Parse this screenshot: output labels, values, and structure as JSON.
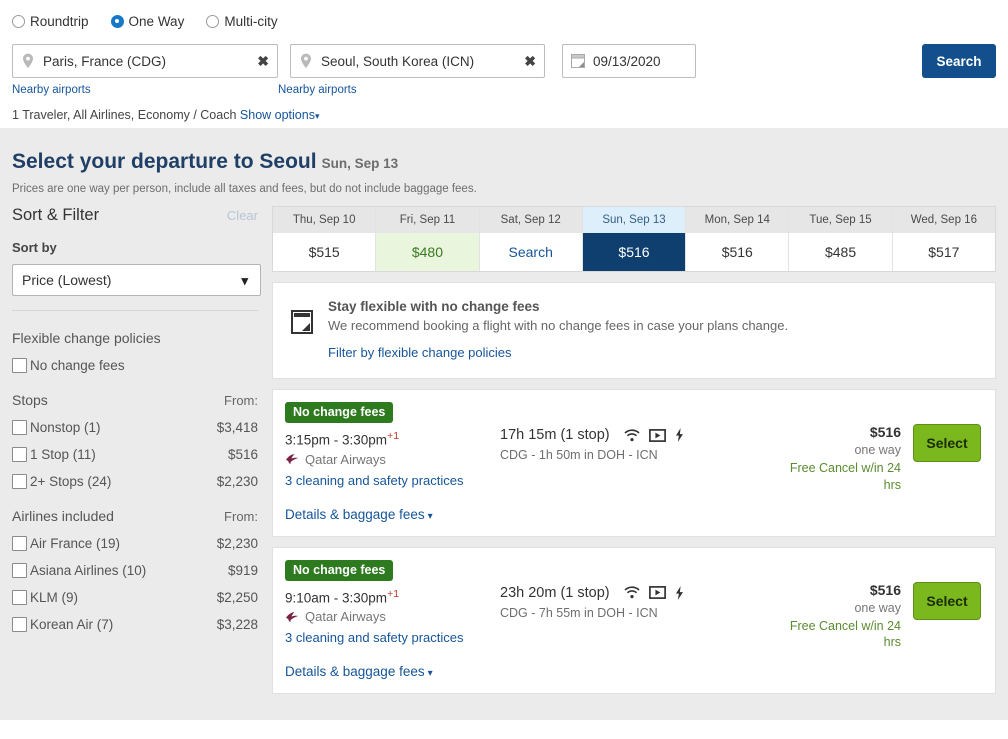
{
  "search": {
    "trip_types": [
      {
        "label": "Roundtrip",
        "selected": false
      },
      {
        "label": "One Way",
        "selected": true
      },
      {
        "label": "Multi-city",
        "selected": false
      }
    ],
    "origin": {
      "value": "Paris, France (CDG)",
      "nearby_label": "Nearby airports",
      "clear_label": "✖"
    },
    "destination": {
      "value": "Seoul, South Korea (ICN)",
      "nearby_label": "Nearby airports",
      "clear_label": "✖"
    },
    "date": {
      "value": "09/13/2020"
    },
    "search_button": "Search",
    "options_summary": "1 Traveler, All Airlines, Economy / Coach",
    "show_options": "Show options"
  },
  "results": {
    "title": "Select your departure to Seoul",
    "title_date": "Sun, Sep 13",
    "disclaimer": "Prices are one way per person, include all taxes and fees, but do not include baggage fees."
  },
  "sidebar": {
    "heading": "Sort & Filter",
    "clear": "Clear",
    "sort_by_label": "Sort by",
    "sort_selected": "Price (Lowest)",
    "sort_options": [
      "Price (Lowest)"
    ],
    "flexible_group": {
      "title": "Flexible change policies",
      "items": [
        {
          "label": "No change fees",
          "price": "",
          "checked": false
        }
      ]
    },
    "stops_group": {
      "title": "Stops",
      "from_label": "From:",
      "items": [
        {
          "label": "Nonstop (1)",
          "price": "$3,418",
          "checked": false
        },
        {
          "label": "1 Stop (11)",
          "price": "$516",
          "checked": false
        },
        {
          "label": "2+ Stops (24)",
          "price": "$2,230",
          "checked": false
        }
      ]
    },
    "airlines_group": {
      "title": "Airlines included",
      "from_label": "From:",
      "items": [
        {
          "label": "Air France (19)",
          "price": "$2,230",
          "checked": false
        },
        {
          "label": "Asiana Airlines (10)",
          "price": "$919",
          "checked": false
        },
        {
          "label": "KLM (9)",
          "price": "$2,250",
          "checked": false
        },
        {
          "label": "Korean Air (7)",
          "price": "$3,228",
          "checked": false
        }
      ]
    }
  },
  "date_strip": [
    {
      "day": "Thu, Sep 10",
      "price": "$515",
      "state": "normal"
    },
    {
      "day": "Fri, Sep 11",
      "price": "$480",
      "state": "cheap"
    },
    {
      "day": "Sat, Sep 12",
      "price": "Search",
      "state": "search"
    },
    {
      "day": "Sun, Sep 13",
      "price": "$516",
      "state": "active"
    },
    {
      "day": "Mon, Sep 14",
      "price": "$516",
      "state": "normal"
    },
    {
      "day": "Tue, Sep 15",
      "price": "$485",
      "state": "normal"
    },
    {
      "day": "Wed, Sep 16",
      "price": "$517",
      "state": "normal"
    }
  ],
  "flex_banner": {
    "title": "Stay flexible with no change fees",
    "text": "We recommend booking a flight with no change fees in case your plans change.",
    "link": "Filter by flexible change policies"
  },
  "flights": [
    {
      "badge": "No change fees",
      "times": "3:15pm - 3:30pm",
      "plus_days": "+1",
      "airline": "Qatar Airways",
      "safety": "3 cleaning and safety practices",
      "details": "Details & baggage fees",
      "duration": "17h 15m (1 stop)",
      "route": "CDG - 1h 50m in DOH - ICN",
      "amenities": [
        "wifi-icon",
        "entertainment-icon",
        "power-icon"
      ],
      "price": "$516",
      "fare_type": "one way",
      "free_cancel": "Free Cancel w/in 24 hrs",
      "select_label": "Select"
    },
    {
      "badge": "No change fees",
      "times": "9:10am - 3:30pm",
      "plus_days": "+1",
      "airline": "Qatar Airways",
      "safety": "3 cleaning and safety practices",
      "details": "Details & baggage fees",
      "duration": "23h 20m (1 stop)",
      "route": "CDG - 7h 55m in DOH - ICN",
      "amenities": [
        "wifi-icon",
        "entertainment-icon",
        "power-icon"
      ],
      "price": "$516",
      "fare_type": "one way",
      "free_cancel": "Free Cancel w/in 24 hrs",
      "select_label": "Select"
    }
  ],
  "colors": {
    "brand_blue": "#134f8c",
    "active_date": "#0e3f6e",
    "badge_green": "#2d7a1f",
    "select_green": "#7ab81e",
    "link_blue": "#16559a",
    "cheap_green": "#3a7a22"
  }
}
